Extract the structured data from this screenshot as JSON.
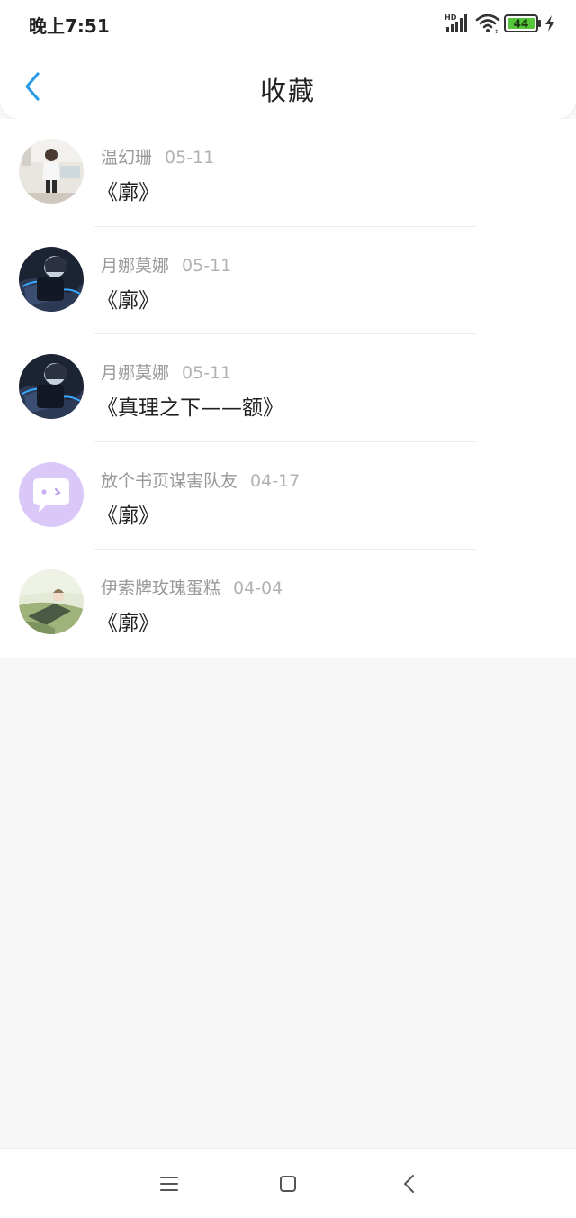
{
  "status_bar": {
    "time": "晚上7:51",
    "hd_label": "HD",
    "battery_level": "44",
    "icons": [
      "signal-icon",
      "wifi-icon",
      "battery-icon",
      "charging-icon"
    ]
  },
  "header": {
    "back_icon": "chevron-left-icon",
    "title": "收藏"
  },
  "favorites": [
    {
      "author": "温幻珊",
      "date": "05-11",
      "title": "《廓》",
      "avatar": "avatar-photo-girl"
    },
    {
      "author": "月娜莫娜",
      "date": "05-11",
      "title": "《廓》",
      "avatar": "avatar-anime-dark"
    },
    {
      "author": "月娜莫娜",
      "date": "05-11",
      "title": "《真理之下——额》",
      "avatar": "avatar-anime-dark"
    },
    {
      "author": "放个书页谋害队友",
      "date": "04-17",
      "title": "《廓》",
      "avatar": "avatar-chat-bubble-purple"
    },
    {
      "author": "伊索牌玫瑰蛋糕",
      "date": "04-04",
      "title": "《廓》",
      "avatar": "avatar-anime-green"
    }
  ],
  "colors": {
    "accent": "#2a9ae6",
    "avatar_purple": "#d9c8f8"
  },
  "nav_bar": {
    "icons": [
      "menu-icon",
      "home-icon",
      "back-icon"
    ]
  }
}
